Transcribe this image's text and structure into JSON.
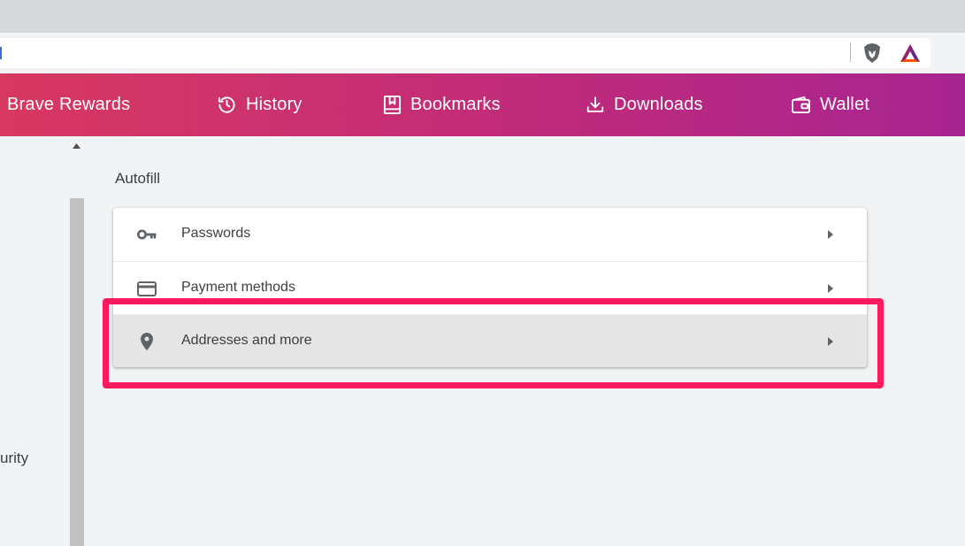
{
  "nav": {
    "items": [
      {
        "label": "Brave Rewards",
        "icon": "brave-rewards-icon"
      },
      {
        "label": "History",
        "icon": "history-icon"
      },
      {
        "label": "Bookmarks",
        "icon": "bookmarks-icon"
      },
      {
        "label": "Downloads",
        "icon": "downloads-icon"
      },
      {
        "label": "Wallet",
        "icon": "wallet-icon"
      }
    ]
  },
  "sidebar": {
    "partial_item": "urity"
  },
  "autofill": {
    "title": "Autofill",
    "rows": [
      {
        "label": "Passwords",
        "icon": "key-icon"
      },
      {
        "label": "Payment methods",
        "icon": "credit-card-icon"
      },
      {
        "label": "Addresses and more",
        "icon": "location-pin-icon",
        "highlighted": true
      }
    ]
  },
  "colors": {
    "nav_gradient_start": "#d73960",
    "nav_gradient_end": "#a62491",
    "highlight_border": "#ff1a5e",
    "page_bg": "#f1f3f4"
  }
}
